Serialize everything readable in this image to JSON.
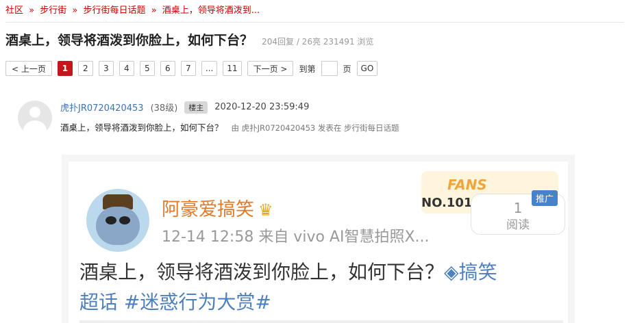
{
  "breadcrumb": {
    "items": [
      "社区",
      "步行街",
      "步行街每日话题",
      "酒桌上，领导将酒泼到..."
    ],
    "separator": "»"
  },
  "thread": {
    "title": "酒桌上，领导将酒泼到你脸上，如何下台？",
    "stats": "204回复 / 26亮 231491 浏览"
  },
  "pagination": {
    "prev": "< 上一页",
    "pages": [
      "1",
      "2",
      "3",
      "4",
      "5",
      "6",
      "7",
      "...",
      "11"
    ],
    "current": "1",
    "next": "下一页 >",
    "goto_prefix": "到第",
    "goto_suffix": "页",
    "go": "GO"
  },
  "post": {
    "username": "虎扑JR0720420453",
    "level": "(38级)",
    "badge": "楼主",
    "timestamp": "2020-12-20 23:59:49",
    "content": "酒桌上，领导将酒泼到你脸上，如何下台？",
    "source": "由 虎扑JR0720420453 发表在 步行街每日话题"
  },
  "embedded": {
    "name": "阿豪爱搞笑",
    "time_source": "12-14 12:58  来自 vivo AI智慧拍照X...",
    "fans": "FANS",
    "fans_no": "NO.1018",
    "read_count": "1",
    "read_label": "阅读",
    "promo": "推广",
    "text": "酒桌上，领导将酒泼到你脸上，如何下台？",
    "tag_icon": "◈",
    "tag1": "搞笑",
    "tag1_suffix": "超话",
    "tag2": "#迷惑行为大赏#"
  },
  "colors": {
    "accent": "#c4161c",
    "link": "#3b74b8",
    "orange_name": "#e07a2a",
    "tag_blue": "#4e7fbe"
  }
}
